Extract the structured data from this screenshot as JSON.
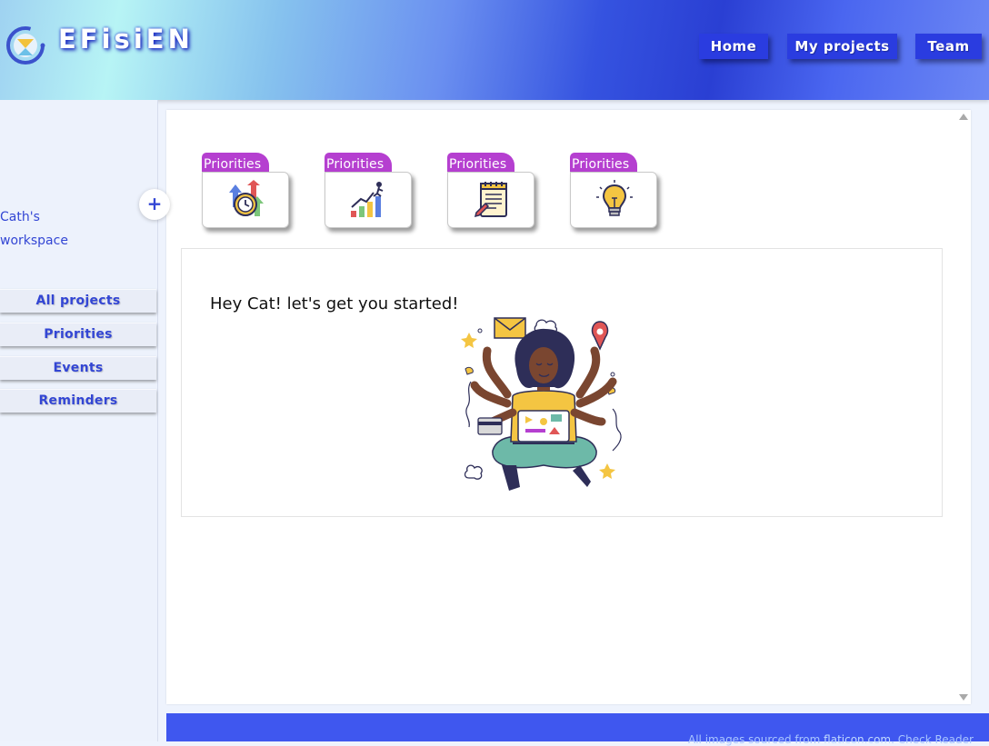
{
  "header": {
    "brand": "EFisiEN",
    "nav": [
      "Home",
      "My projects",
      "Team"
    ]
  },
  "sidebar": {
    "workspace_line1": "Cath's",
    "workspace_line2": "workspace",
    "add_label": "+",
    "items": [
      "All projects",
      "Priorities",
      "Events",
      "Reminders"
    ]
  },
  "folders": [
    {
      "tab": "Priorities",
      "icon": "time-management-icon"
    },
    {
      "tab": "Priorities",
      "icon": "growth-chart-icon"
    },
    {
      "tab": "Priorities",
      "icon": "notepad-icon"
    },
    {
      "tab": "Priorities",
      "icon": "lightbulb-icon"
    }
  ],
  "main": {
    "greeting": "Hey Cat! let's get you started!",
    "illustration": "multitasking-woman-illustration"
  },
  "footer": {
    "text_prefix": "All images sourced from ",
    "link": "flaticon.com",
    "text_suffix": ". Check Reader"
  },
  "colors": {
    "accent": "#2a3ce0",
    "folder_tab": "#b53fd0",
    "sidebar_text": "#3346d4",
    "footer": "#3f57ef"
  }
}
